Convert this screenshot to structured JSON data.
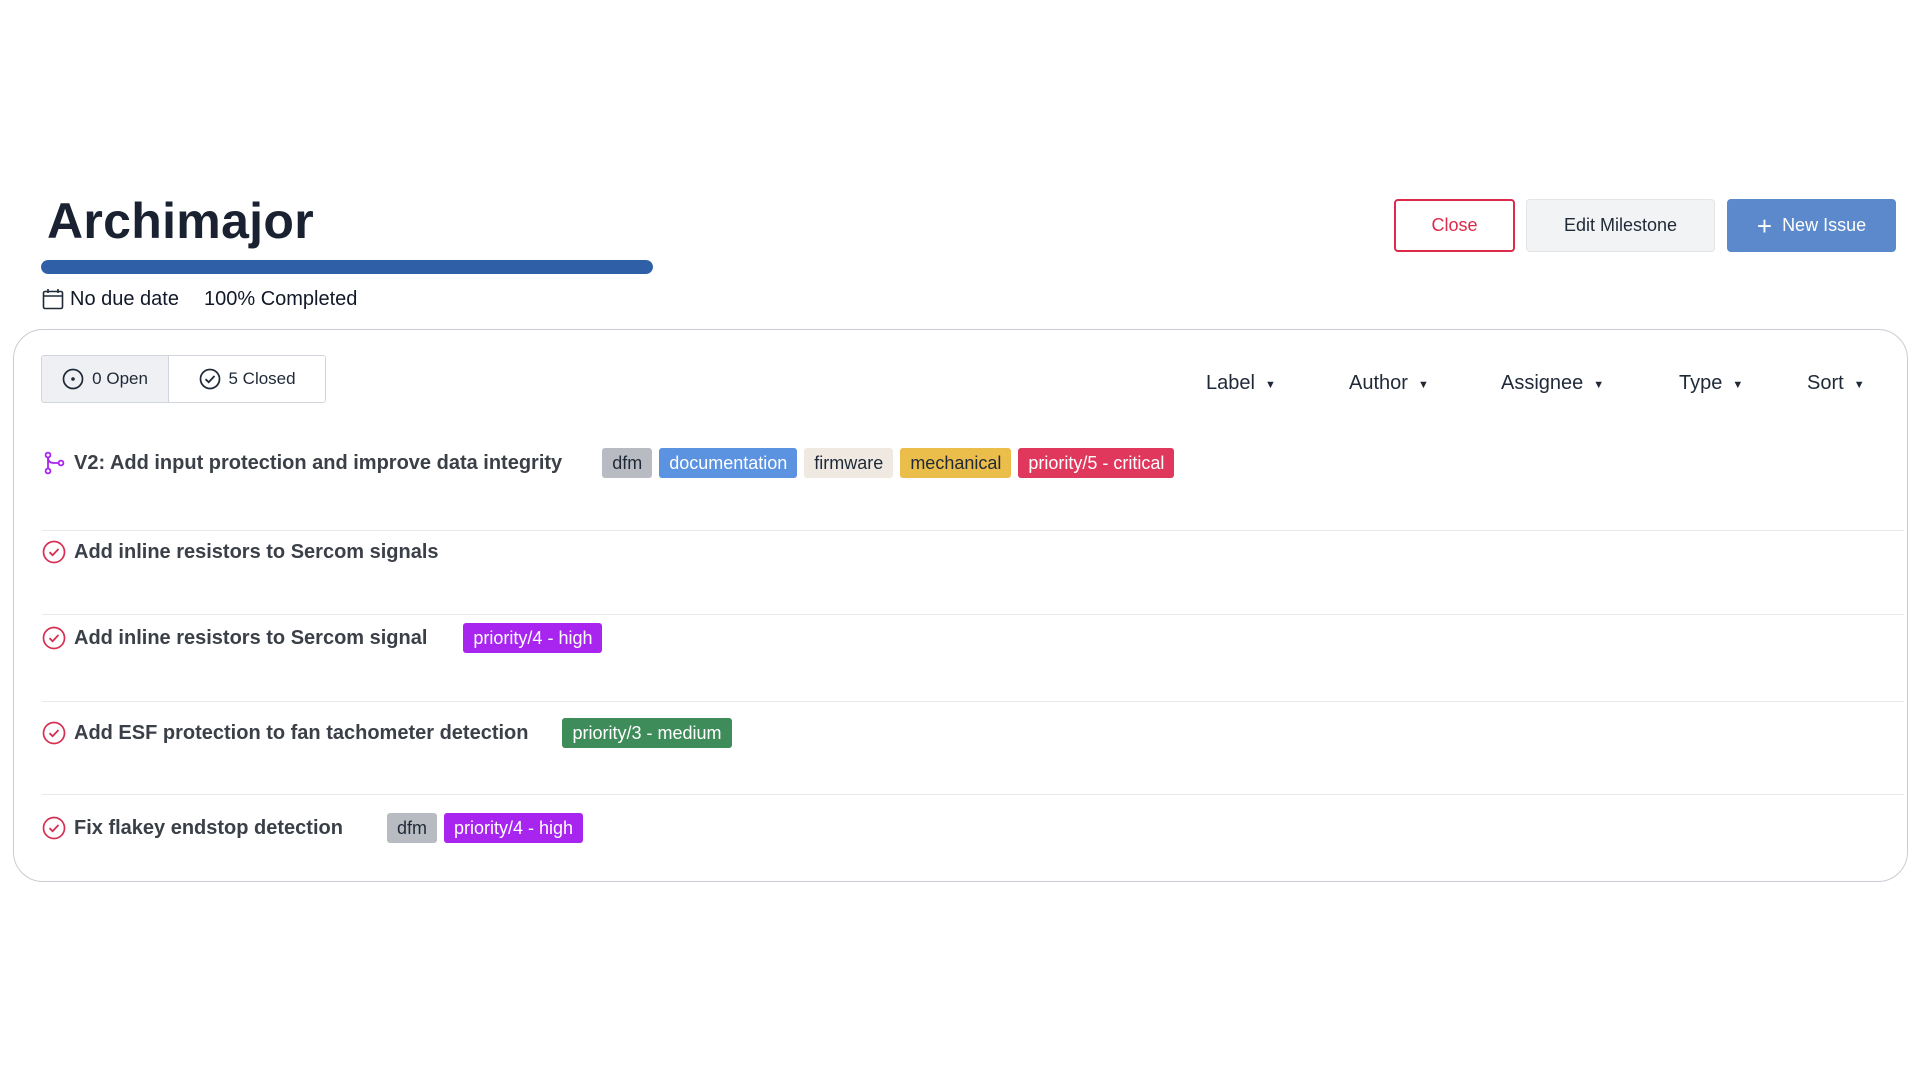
{
  "milestone": {
    "title": "Archimajor",
    "progress_fraction": 1.0,
    "due": "No due date",
    "completed": "100% Completed"
  },
  "buttons": {
    "close": "Close",
    "edit": "Edit Milestone",
    "new_issue": "New Issue"
  },
  "state_tabs": {
    "open": "0 Open",
    "closed": "5 Closed"
  },
  "filters": [
    "Label",
    "Author",
    "Assignee",
    "Type",
    "Sort"
  ],
  "labels": {
    "dfm": {
      "text": "dfm",
      "bg": "#b8bcc2",
      "fg": "#1f2937"
    },
    "documentation": {
      "text": "documentation",
      "bg": "#5c93e0",
      "fg": "#ffffff"
    },
    "firmware": {
      "text": "firmware",
      "bg": "#efe9e2",
      "fg": "#1f2937"
    },
    "mechanical": {
      "text": "mechanical",
      "bg": "#ebbd4b",
      "fg": "#1f2937"
    },
    "p5": {
      "text": "priority/5 - critical",
      "bg": "#e0385d",
      "fg": "#ffffff"
    },
    "p4": {
      "text": "priority/4 - high",
      "bg": "#a725ef",
      "fg": "#ffffff"
    },
    "p3": {
      "text": "priority/3 - medium",
      "bg": "#3e8c59",
      "fg": "#ffffff"
    }
  },
  "issues": [
    {
      "title": "V2: Add input protection and improve data integrity",
      "type": "pull-request-merged",
      "labels": [
        "dfm",
        "documentation",
        "firmware",
        "mechanical",
        "priority/5 - critical"
      ]
    },
    {
      "title": "Add inline resistors to Sercom signals",
      "type": "issue-closed",
      "labels": []
    },
    {
      "title": "Add inline resistors to Sercom signal",
      "type": "issue-closed",
      "labels": [
        "priority/4 - high"
      ]
    },
    {
      "title": "Add ESF protection to fan tachometer detection",
      "type": "issue-closed",
      "labels": [
        "priority/3 - medium"
      ]
    },
    {
      "title": "Fix flakey endstop detection",
      "type": "issue-closed",
      "labels": [
        "dfm",
        "priority/4 - high"
      ]
    }
  ],
  "colors": {
    "accent": "#2f5fa7",
    "primary_button": "#5b89cb",
    "danger": "#db2a4a",
    "merged_icon": "#a725ef",
    "closed_icon": "#d62f52"
  }
}
